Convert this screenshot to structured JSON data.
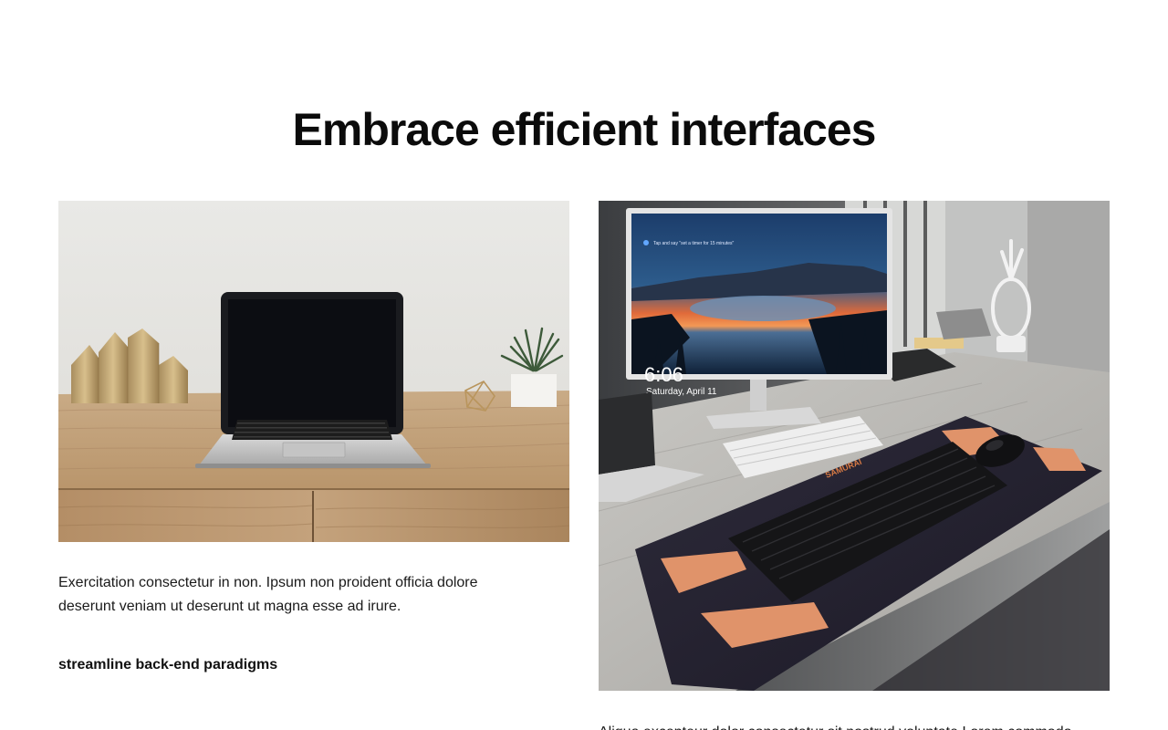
{
  "section": {
    "title": "Embrace efficient interfaces"
  },
  "cards": [
    {
      "text": "Exercitation consectetur in non. Ipsum non proident officia dolore deserunt veniam ut deserunt ut magna esse ad irure.",
      "link_label": "streamline back-end paradigms"
    },
    {
      "text": "Aliqua excepteur dolor consectetur sit nostrud voluptate Lorem commodo",
      "screen_time": "6:06",
      "screen_date": "Saturday, April 11",
      "screen_hint": "Tap and say \"set a timer for 15 minutes\"",
      "mousepad_brand": "SAMURAI"
    }
  ]
}
